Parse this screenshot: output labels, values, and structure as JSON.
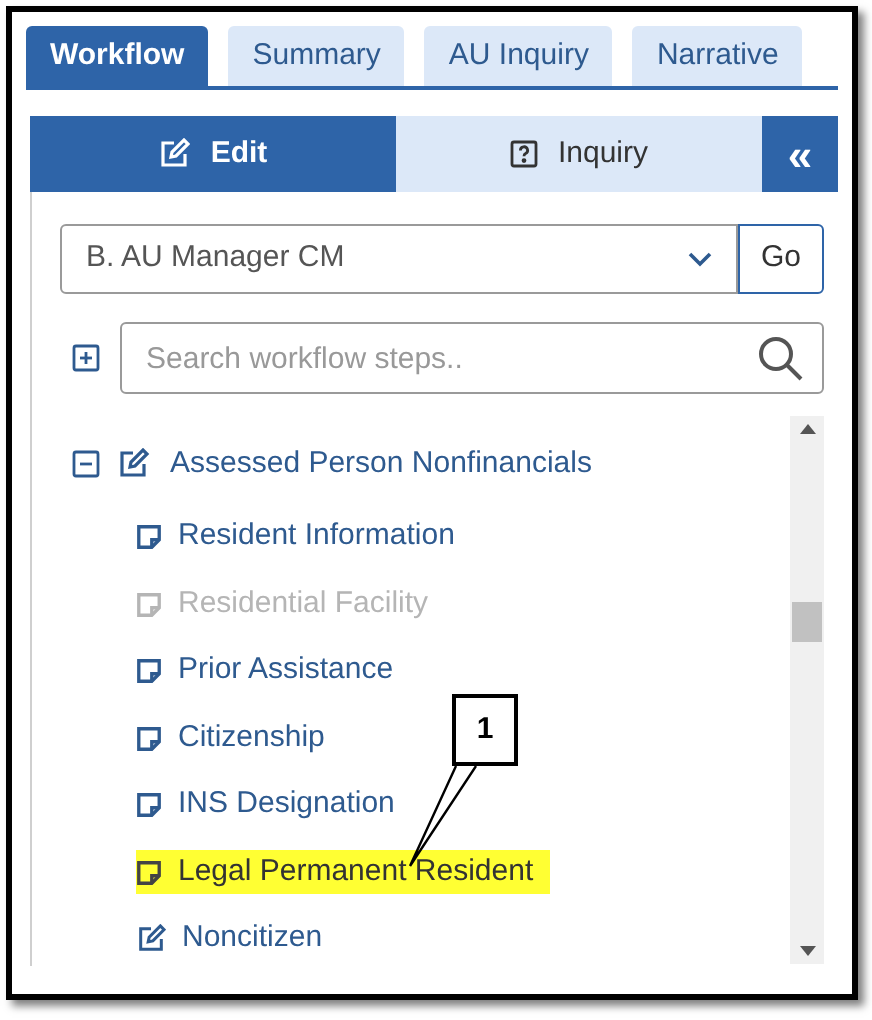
{
  "tabs": [
    {
      "label": "Workflow",
      "selected": true
    },
    {
      "label": "Summary",
      "selected": false
    },
    {
      "label": "AU Inquiry",
      "selected": false
    },
    {
      "label": "Narrative",
      "selected": false
    }
  ],
  "mode_tabs": [
    {
      "label": "Edit",
      "kind": "edit",
      "selected": true
    },
    {
      "label": "Inquiry",
      "kind": "inquiry",
      "selected": false
    }
  ],
  "collapse_button": {
    "label": "«"
  },
  "workflow_select": {
    "value": "B. AU Manager CM"
  },
  "go_button": {
    "label": "Go"
  },
  "search": {
    "placeholder": "Search workflow steps.."
  },
  "tree": {
    "label": "Assessed Person Nonfinancials",
    "expanded": true,
    "children": [
      {
        "label": "Resident Information",
        "kind": "note",
        "disabled": false,
        "highlighted": false
      },
      {
        "label": "Residential Facility",
        "kind": "note",
        "disabled": true,
        "highlighted": false
      },
      {
        "label": "Prior Assistance",
        "kind": "note",
        "disabled": false,
        "highlighted": false
      },
      {
        "label": "Citizenship",
        "kind": "note",
        "disabled": false,
        "highlighted": false
      },
      {
        "label": "INS Designation",
        "kind": "note",
        "disabled": false,
        "highlighted": false
      },
      {
        "label": "Legal Permanent Resident",
        "kind": "note",
        "disabled": false,
        "highlighted": true
      },
      {
        "label": "Noncitizen",
        "kind": "edit",
        "disabled": false,
        "highlighted": false
      }
    ]
  },
  "callout": {
    "label": "1"
  }
}
